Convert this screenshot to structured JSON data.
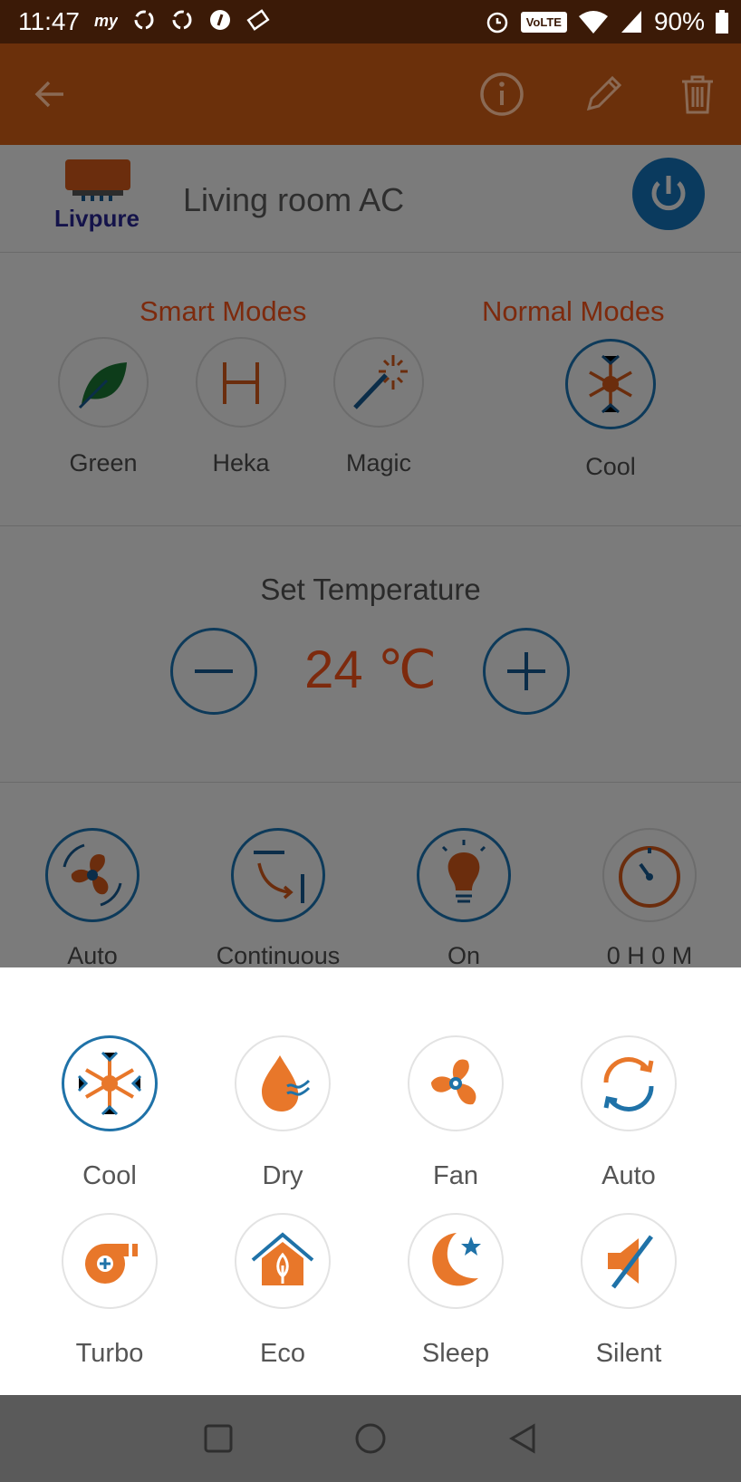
{
  "status_bar": {
    "time": "11:47",
    "volte": "VoLTE",
    "battery": "90%",
    "notification_icons": [
      "my-icon",
      "sync-icon",
      "sync-icon",
      "app-icon",
      "ticket-icon"
    ]
  },
  "app_bar": {
    "back_icon": "arrow-left-icon",
    "actions": [
      "info-icon",
      "edit-icon",
      "delete-icon"
    ]
  },
  "device": {
    "brand": "Livpure",
    "name": "Living room AC",
    "power_icon": "power-icon"
  },
  "modes": {
    "smart_title": "Smart Modes",
    "normal_title": "Normal Modes",
    "smart": [
      {
        "label": "Green",
        "icon": "leaf-icon"
      },
      {
        "label": "Heka",
        "icon": "heka-icon"
      },
      {
        "label": "Magic",
        "icon": "magic-wand-icon"
      }
    ],
    "normal": {
      "label": "Cool",
      "icon": "snowflake-icon"
    }
  },
  "temperature": {
    "title": "Set Temperature",
    "value": "24 ℃",
    "decrease_icon": "minus-icon",
    "increase_icon": "plus-icon"
  },
  "controls": [
    {
      "label": "Auto",
      "icon": "fan-speed-icon"
    },
    {
      "label": "Continuous",
      "icon": "swing-icon"
    },
    {
      "label": "On",
      "icon": "bulb-icon"
    },
    {
      "label": "0 H 0 M",
      "icon": "timer-icon"
    }
  ],
  "mode_sheet": {
    "options": [
      {
        "label": "Cool",
        "icon": "snowflake-icon",
        "selected": true
      },
      {
        "label": "Dry",
        "icon": "drop-icon",
        "selected": false
      },
      {
        "label": "Fan",
        "icon": "fan-icon",
        "selected": false
      },
      {
        "label": "Auto",
        "icon": "auto-cycle-icon",
        "selected": false
      },
      {
        "label": "Turbo",
        "icon": "turbo-icon",
        "selected": false
      },
      {
        "label": "Eco",
        "icon": "eco-icon",
        "selected": false
      },
      {
        "label": "Sleep",
        "icon": "sleep-icon",
        "selected": false
      },
      {
        "label": "Silent",
        "icon": "silent-icon",
        "selected": false
      }
    ]
  },
  "colors": {
    "accent_orange": "#E8772A",
    "accent_blue": "#1F72A8",
    "app_bar": "#C75A16"
  },
  "nav_bar": [
    "recents-icon",
    "home-icon",
    "back-icon"
  ]
}
